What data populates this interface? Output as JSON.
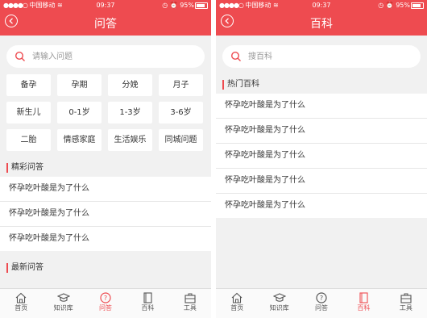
{
  "left": {
    "status": {
      "carrier": "中国移动",
      "time": "09:37",
      "battery": "95%"
    },
    "title": "问答",
    "search_placeholder": "请输入问题",
    "categories": [
      "备孕",
      "孕期",
      "分娩",
      "月子",
      "新生儿",
      "0-1岁",
      "1-3岁",
      "3-6岁",
      "二胎",
      "情感家庭",
      "生活娱乐",
      "同城问题"
    ],
    "section_featured": "精彩问答",
    "featured_items": [
      "怀孕吃叶酸是为了什么",
      "怀孕吃叶酸是为了什么",
      "怀孕吃叶酸是为了什么"
    ],
    "section_latest": "最新问答",
    "tabs": [
      {
        "label": "首页",
        "icon": "home-icon"
      },
      {
        "label": "知识库",
        "icon": "graduation-cap-icon"
      },
      {
        "label": "问答",
        "icon": "question-icon"
      },
      {
        "label": "百科",
        "icon": "book-icon"
      },
      {
        "label": "工具",
        "icon": "toolbox-icon"
      }
    ],
    "active_tab": 2
  },
  "right": {
    "status": {
      "carrier": "中国移动",
      "time": "09:37",
      "battery": "95%"
    },
    "title": "百科",
    "search_placeholder": "搜百科",
    "section_hot": "热门百科",
    "hot_items": [
      "怀孕吃叶酸是为了什么",
      "怀孕吃叶酸是为了什么",
      "怀孕吃叶酸是为了什么",
      "怀孕吃叶酸是为了什么",
      "怀孕吃叶酸是为了什么"
    ],
    "tabs": [
      {
        "label": "首页",
        "icon": "home-icon"
      },
      {
        "label": "知识库",
        "icon": "graduation-cap-icon"
      },
      {
        "label": "问答",
        "icon": "question-icon"
      },
      {
        "label": "百科",
        "icon": "book-icon"
      },
      {
        "label": "工具",
        "icon": "toolbox-icon"
      }
    ],
    "active_tab": 3
  },
  "colors": {
    "accent": "#ee4b50",
    "background": "#f1f1f1"
  }
}
